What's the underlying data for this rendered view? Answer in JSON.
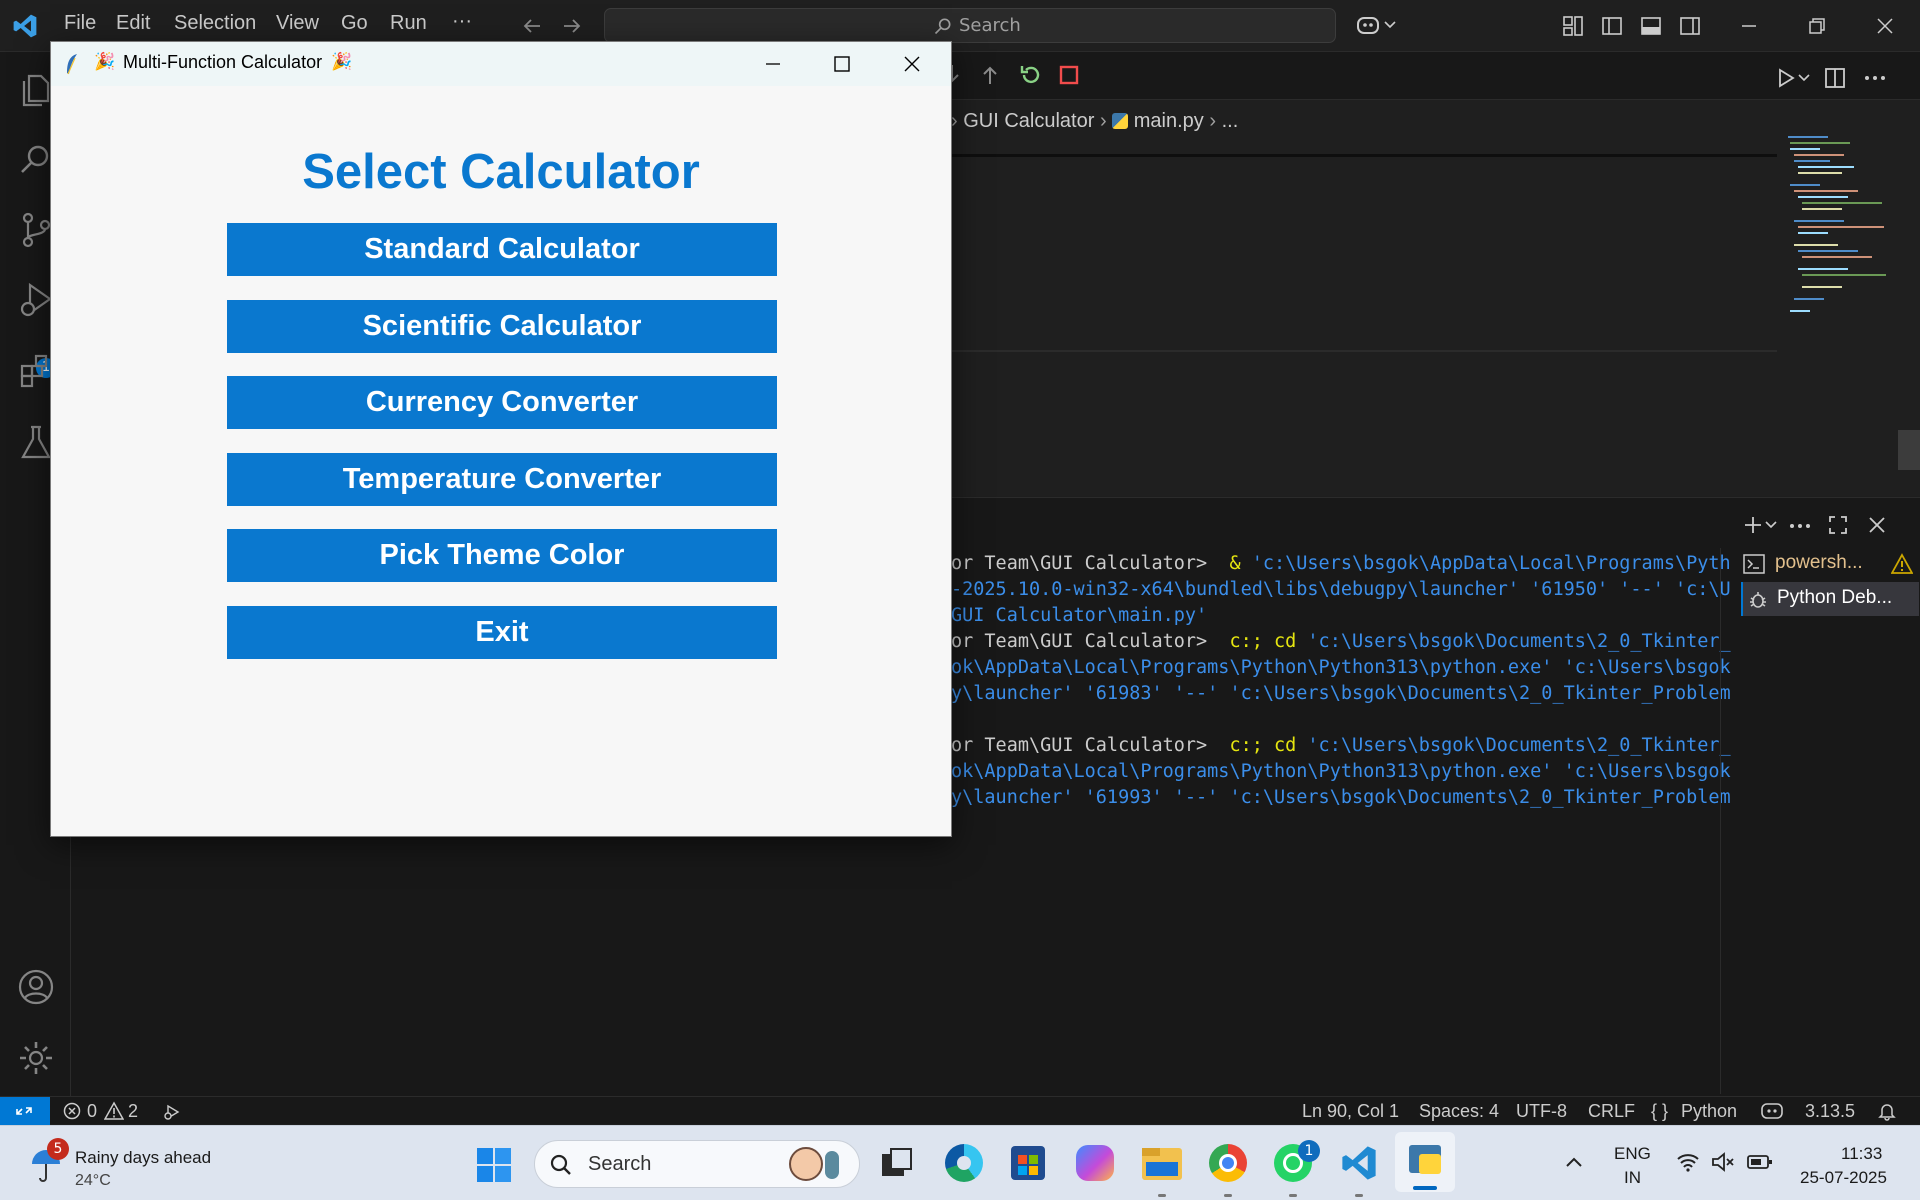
{
  "menu": [
    "File",
    "Edit",
    "Selection",
    "View",
    "Go",
    "Run",
    "···"
  ],
  "search": {
    "placeholder": "Search"
  },
  "breadcrumb": {
    "folder": "GUI Calculator",
    "file": "main.py",
    "more": "..."
  },
  "terminal_lines": [
    [
      [
        "or Team\\GUI Calculator>  ",
        "tw"
      ],
      [
        "& ",
        "ty"
      ],
      [
        "'c:\\Users\\bsgok\\AppData\\Local\\Programs\\Pyth",
        "tb"
      ]
    ],
    [
      [
        "-2025.10.0-win32-x64\\bundled\\libs\\debugpy\\launcher' '61950' '--' 'c:\\U",
        "tb"
      ]
    ],
    [
      [
        "GUI Calculator\\main.py'",
        "tb"
      ]
    ],
    [
      [
        "or Team\\GUI Calculator>  ",
        "tw"
      ],
      [
        "c:; cd ",
        "ty"
      ],
      [
        "'c:\\Users\\bsgok\\Documents\\2_0_Tkinter_",
        "tb"
      ]
    ],
    [
      [
        "ok\\AppData\\Local\\Programs\\Python\\Python313\\python.exe' 'c:\\Users\\bsgok",
        "tb"
      ]
    ],
    [
      [
        "y\\launcher' '61983' '--' 'c:\\Users\\bsgok\\Documents\\2_0_Tkinter_Problem",
        "tb"
      ]
    ],
    [
      [
        "",
        ""
      ]
    ],
    [
      [
        "or Team\\GUI Calculator>  ",
        "tw"
      ],
      [
        "c:; cd ",
        "ty"
      ],
      [
        "'c:\\Users\\bsgok\\Documents\\2_0_Tkinter_",
        "tb"
      ]
    ],
    [
      [
        "ok\\AppData\\Local\\Programs\\Python\\Python313\\python.exe' 'c:\\Users\\bsgok",
        "tb"
      ]
    ],
    [
      [
        "y\\launcher' '61993' '--' 'c:\\Users\\bsgok\\Documents\\2_0_Tkinter_Problem",
        "tb"
      ]
    ]
  ],
  "terminal_list": [
    {
      "label": "powersh...",
      "warning": true
    },
    {
      "label": "Python Deb...",
      "warning": false
    }
  ],
  "status": {
    "errors": "0",
    "warnings": "2",
    "position": "Ln 90, Col 1",
    "spaces": "Spaces: 4",
    "encoding": "UTF-8",
    "eol": "CRLF",
    "language": "Python",
    "version": "3.13.5"
  },
  "debug_badge": "1",
  "taskbar": {
    "weather_title": "Rainy days ahead",
    "weather_temp": "24°C",
    "weather_badge": "5",
    "search": "Search",
    "lang1": "ENG",
    "lang2": "IN",
    "time": "11:33",
    "date": "25-07-2025",
    "whatsapp_badge": "1"
  },
  "tk": {
    "window_title": "Multi-Function Calculator",
    "heading": "Select Calculator",
    "buttons": [
      "Standard Calculator",
      "Scientific Calculator",
      "Currency Converter",
      "Temperature Converter",
      "Pick Theme Color",
      "Exit"
    ],
    "accent": "#0a78cf"
  }
}
